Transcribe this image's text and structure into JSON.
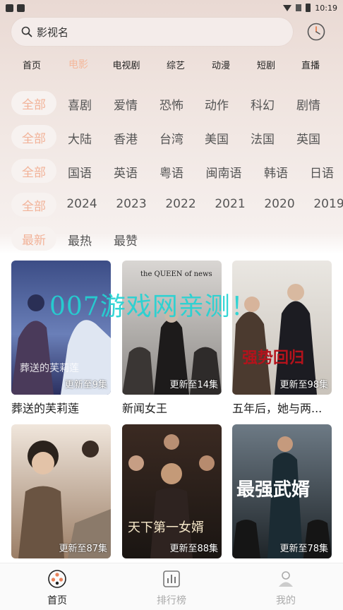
{
  "status_bar": {
    "time": "10:19"
  },
  "search": {
    "placeholder": "影视名"
  },
  "nav": {
    "items": [
      {
        "label": "首页"
      },
      {
        "label": "电影",
        "active": true
      },
      {
        "label": "电视剧"
      },
      {
        "label": "综艺"
      },
      {
        "label": "动漫"
      },
      {
        "label": "短剧"
      },
      {
        "label": "直播"
      }
    ]
  },
  "filters": {
    "genre": {
      "selected": "全部",
      "options": [
        "喜剧",
        "爱情",
        "恐怖",
        "动作",
        "科幻",
        "剧情"
      ]
    },
    "region": {
      "selected": "全部",
      "options": [
        "大陆",
        "香港",
        "台湾",
        "美国",
        "法国",
        "英国"
      ]
    },
    "language": {
      "selected": "全部",
      "options": [
        "国语",
        "英语",
        "粤语",
        "闽南语",
        "韩语",
        "日语"
      ]
    },
    "year": {
      "selected": "全部",
      "options": [
        "2024",
        "2023",
        "2022",
        "2021",
        "2020",
        "2019"
      ]
    },
    "sort": {
      "selected": "最新",
      "options": [
        "最热",
        "最赞"
      ]
    }
  },
  "movies": [
    {
      "title": "葬送的芙莉莲",
      "update": "更新至9集",
      "poster_text": "葬送的芙莉莲"
    },
    {
      "title": "新闻女王",
      "update": "更新至14集",
      "poster_text": "the QUEEN of news"
    },
    {
      "title": "五年后，她与两...",
      "update": "更新至98集",
      "poster_text": "强势回归"
    },
    {
      "title": "",
      "update": "更新至87集",
      "poster_text": ""
    },
    {
      "title": "",
      "update": "更新至88集",
      "poster_text": "天下第一女婿"
    },
    {
      "title": "",
      "update": "更新至78集",
      "poster_text": "最强武婿"
    }
  ],
  "watermark": "007游戏网亲测！",
  "tabbar": {
    "items": [
      {
        "label": "首页",
        "icon": "film-reel-icon",
        "active": true
      },
      {
        "label": "排行榜",
        "icon": "chart-icon"
      },
      {
        "label": "我的",
        "icon": "profile-icon"
      }
    ]
  },
  "colors": {
    "accent": "#f2b399",
    "watermark": "#23d3d3"
  }
}
